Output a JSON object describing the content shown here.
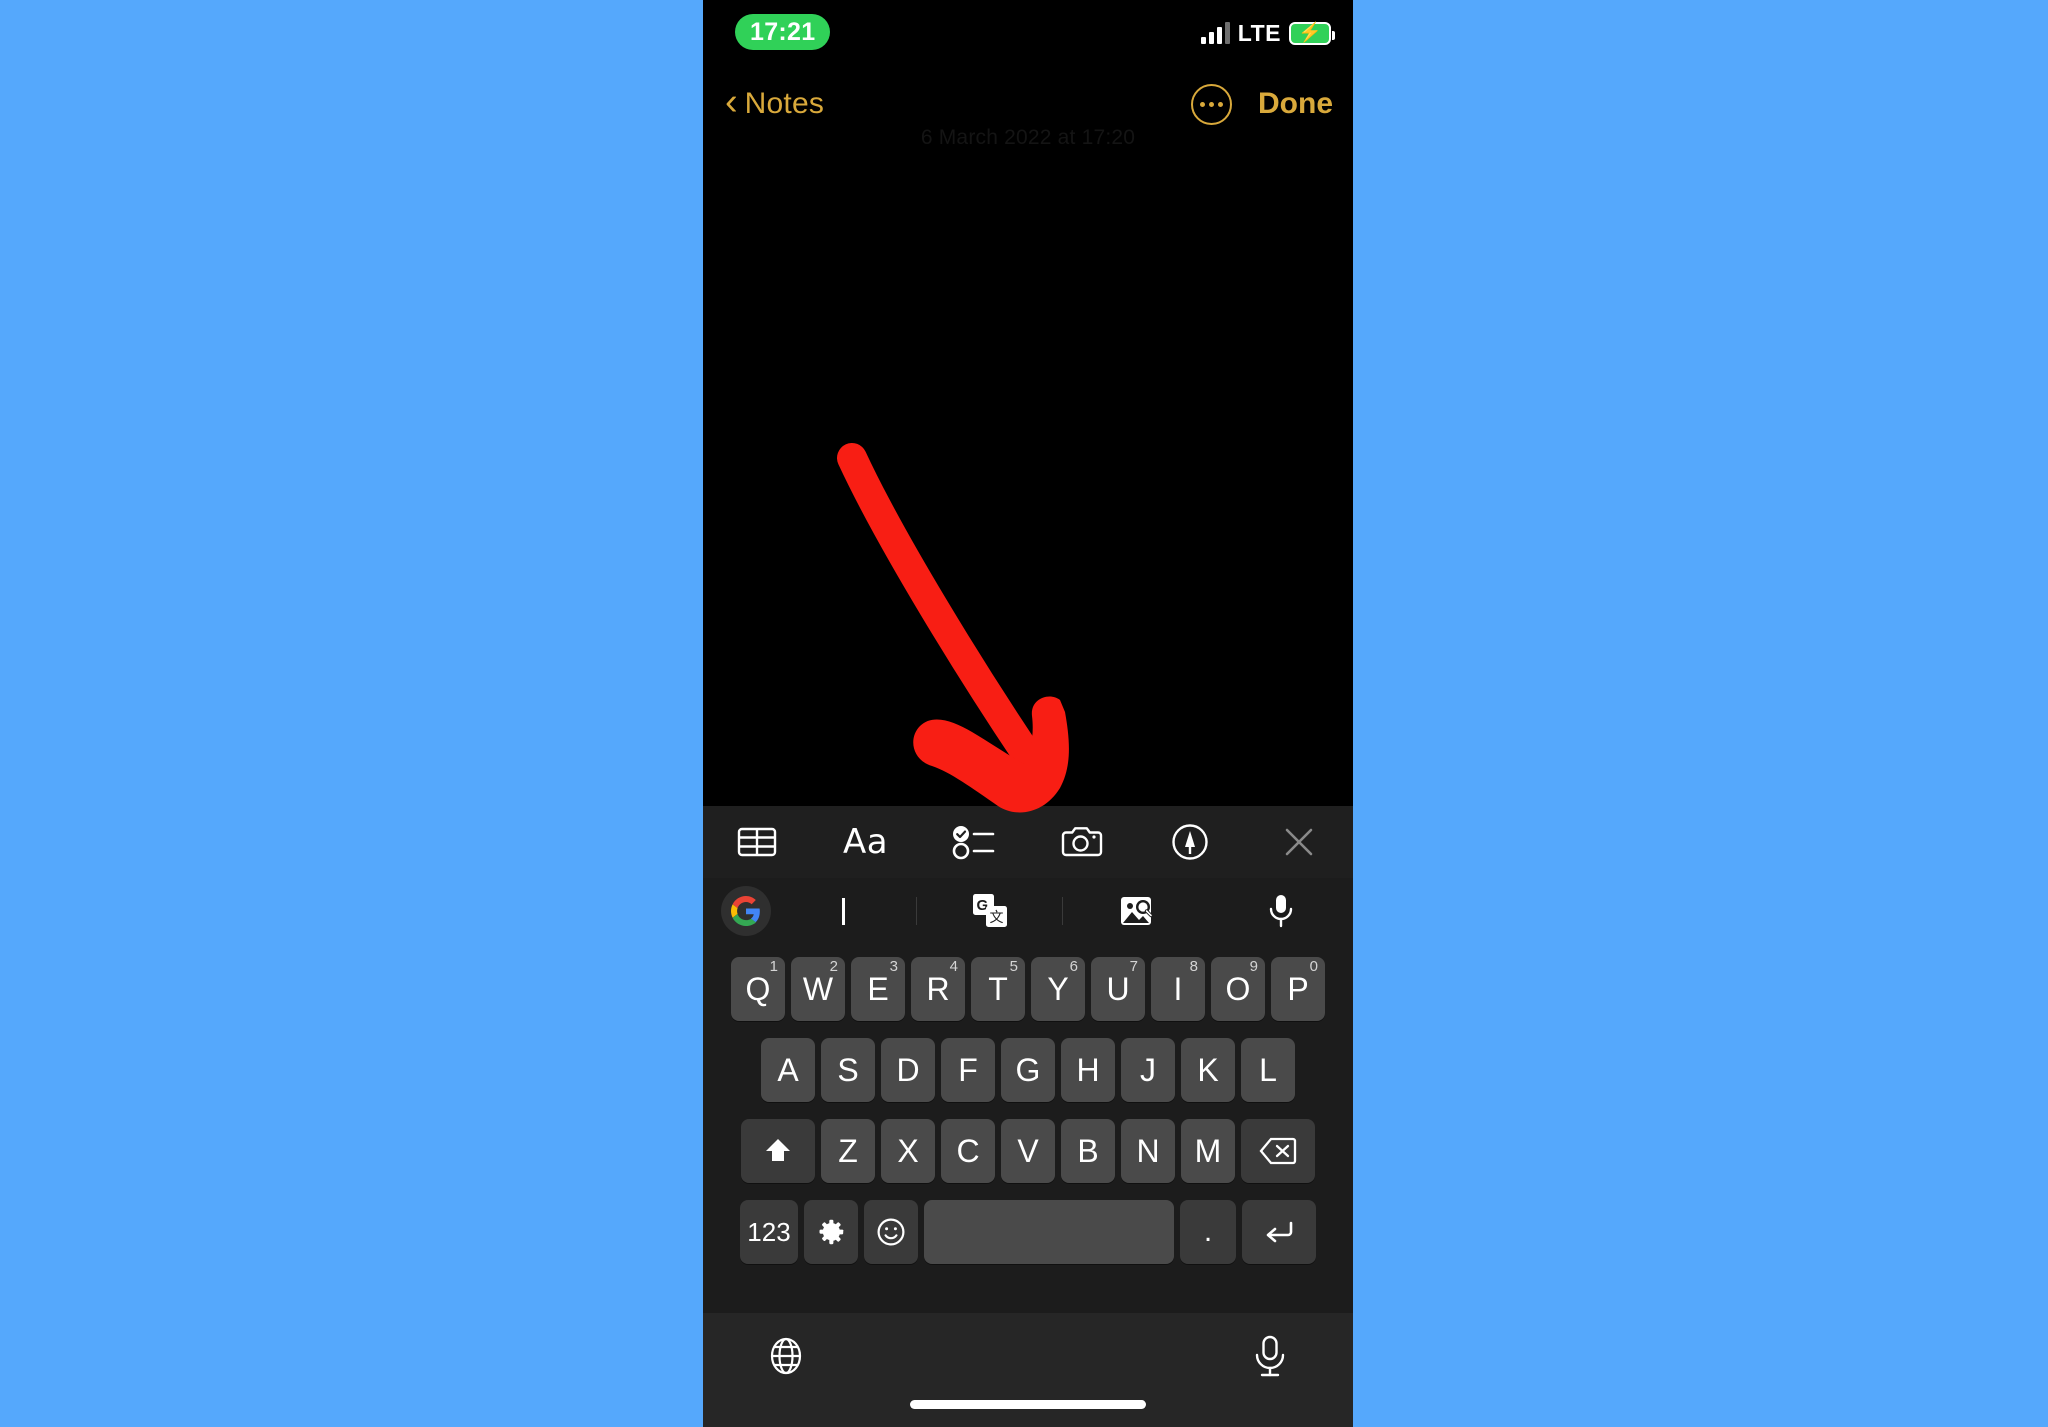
{
  "background_color": "#55a8fc",
  "device": {
    "screen_bg": "#000000",
    "accent_color": "#d9a93b",
    "keyboard_bg": "#1c1c1c",
    "key_color": "#4a4a4a"
  },
  "status_bar": {
    "time": "17:21",
    "time_pill_color": "#30d158",
    "network_label": "LTE",
    "signal_icon": "signal-bars-icon",
    "battery_icon": "battery-charging-icon",
    "battery_color": "#30d158",
    "bolt_glyph": "⚡"
  },
  "nav_bar": {
    "back_icon": "chevron-left-icon",
    "back_label": "Notes",
    "more_icon": "more-options-icon",
    "done_label": "Done"
  },
  "note": {
    "timestamp": "6 March 2022 at 17:20",
    "body_text": ""
  },
  "annotation": {
    "type": "arrow",
    "color": "#f81e14",
    "points_to": "camera-icon",
    "description": "red hand-drawn arrow pointing down-right at the camera button"
  },
  "notes_toolbar": {
    "items": [
      {
        "name": "table-icon",
        "label": "Table"
      },
      {
        "name": "format-icon",
        "label": "Aa"
      },
      {
        "name": "checklist-icon",
        "label": "Checklist"
      },
      {
        "name": "camera-icon",
        "label": "Camera"
      },
      {
        "name": "markup-icon",
        "label": "Markup"
      },
      {
        "name": "close-icon",
        "label": "Close"
      }
    ],
    "aa_label": "Aa"
  },
  "suggestion_strip": {
    "google_logo": "google-logo-icon",
    "caret": "text-caret",
    "translate_icon": "google-translate-icon",
    "lens_icon": "google-lens-icon",
    "mic_icon": "microphone-icon"
  },
  "keyboard": {
    "row1": [
      {
        "letter": "Q",
        "sup": "1"
      },
      {
        "letter": "W",
        "sup": "2"
      },
      {
        "letter": "E",
        "sup": "3"
      },
      {
        "letter": "R",
        "sup": "4"
      },
      {
        "letter": "T",
        "sup": "5"
      },
      {
        "letter": "Y",
        "sup": "6"
      },
      {
        "letter": "U",
        "sup": "7"
      },
      {
        "letter": "I",
        "sup": "8"
      },
      {
        "letter": "O",
        "sup": "9"
      },
      {
        "letter": "P",
        "sup": "0"
      }
    ],
    "row2": [
      "A",
      "S",
      "D",
      "F",
      "G",
      "H",
      "J",
      "K",
      "L"
    ],
    "row3": [
      "Z",
      "X",
      "C",
      "V",
      "B",
      "N",
      "M"
    ],
    "shift_icon": "shift-icon",
    "backspace_icon": "backspace-icon",
    "numeric_label": "123",
    "settings_icon": "gear-icon",
    "emoji_icon": "emoji-icon",
    "space_label": "",
    "period_label": ".",
    "enter_icon": "enter-icon"
  },
  "bottom_bar": {
    "globe_icon": "globe-icon",
    "mic_icon": "microphone-icon",
    "home_indicator": "home-indicator"
  }
}
